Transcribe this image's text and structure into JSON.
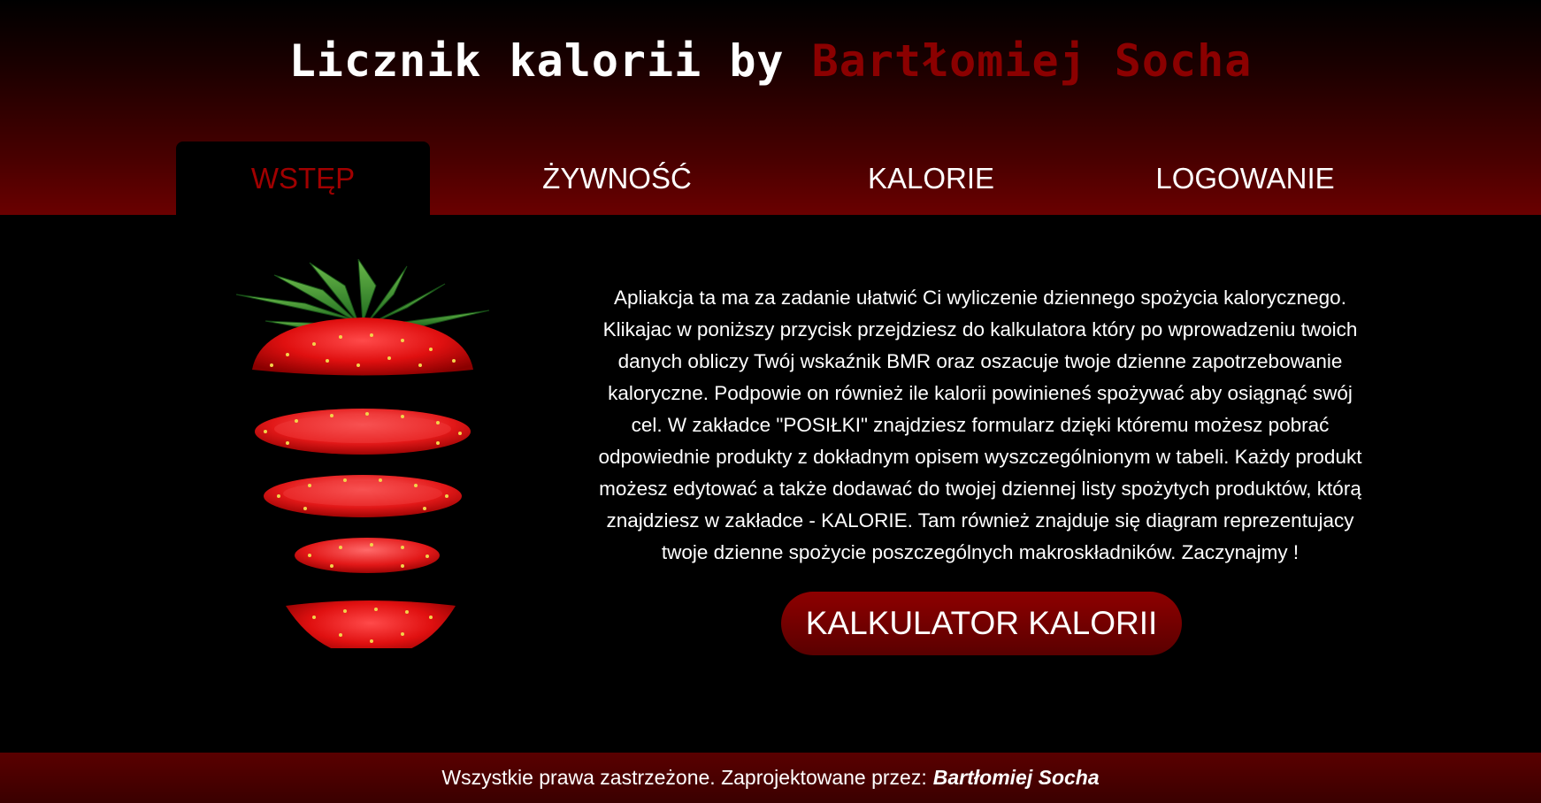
{
  "header": {
    "title_prefix": "Licznik kalorii by",
    "title_author": "Bartłomiej Socha"
  },
  "nav": {
    "tabs": [
      {
        "label": "WSTĘP",
        "active": true
      },
      {
        "label": "ŻYWNOŚĆ",
        "active": false
      },
      {
        "label": "KALORIE",
        "active": false
      },
      {
        "label": "LOGOWANIE",
        "active": false
      }
    ]
  },
  "main": {
    "image_icon": "sliced-strawberry-image",
    "intro_text": "Apliakcja ta ma za zadanie ułatwić Ci wyliczenie dziennego spożycia kalorycznego. Klikajac w poniższy przycisk przejdziesz do kalkulatora który po wprowadzeniu twoich danych obliczy Twój wskaźnik BMR oraz oszacuje twoje dzienne zapotrzebowanie kaloryczne. Podpowie on również ile kalorii powinieneś spożywać aby osiągnąć swój cel. W zakładce \"POSIŁKI\" znajdziesz formularz dzięki któremu możesz pobrać odpowiednie produkty z dokładnym opisem wyszczególnionym w tabeli. Każdy produkt możesz edytować a także dodawać do twojej dziennej listy spożytych produktów, którą znajdziesz w zakładce - KALORIE. Tam również znajduje się diagram reprezentujacy twoje dzienne spożycie poszczególnych makroskładników. Zaczynajmy !",
    "button_label": "KALKULATOR KALORII"
  },
  "footer": {
    "text": "Wszystkie prawa zastrzeżone. Zaprojektowane przez:",
    "author": "Bartłomiej Socha"
  },
  "colors": {
    "accent": "#8b0000",
    "background": "#000000",
    "text": "#ffffff"
  }
}
